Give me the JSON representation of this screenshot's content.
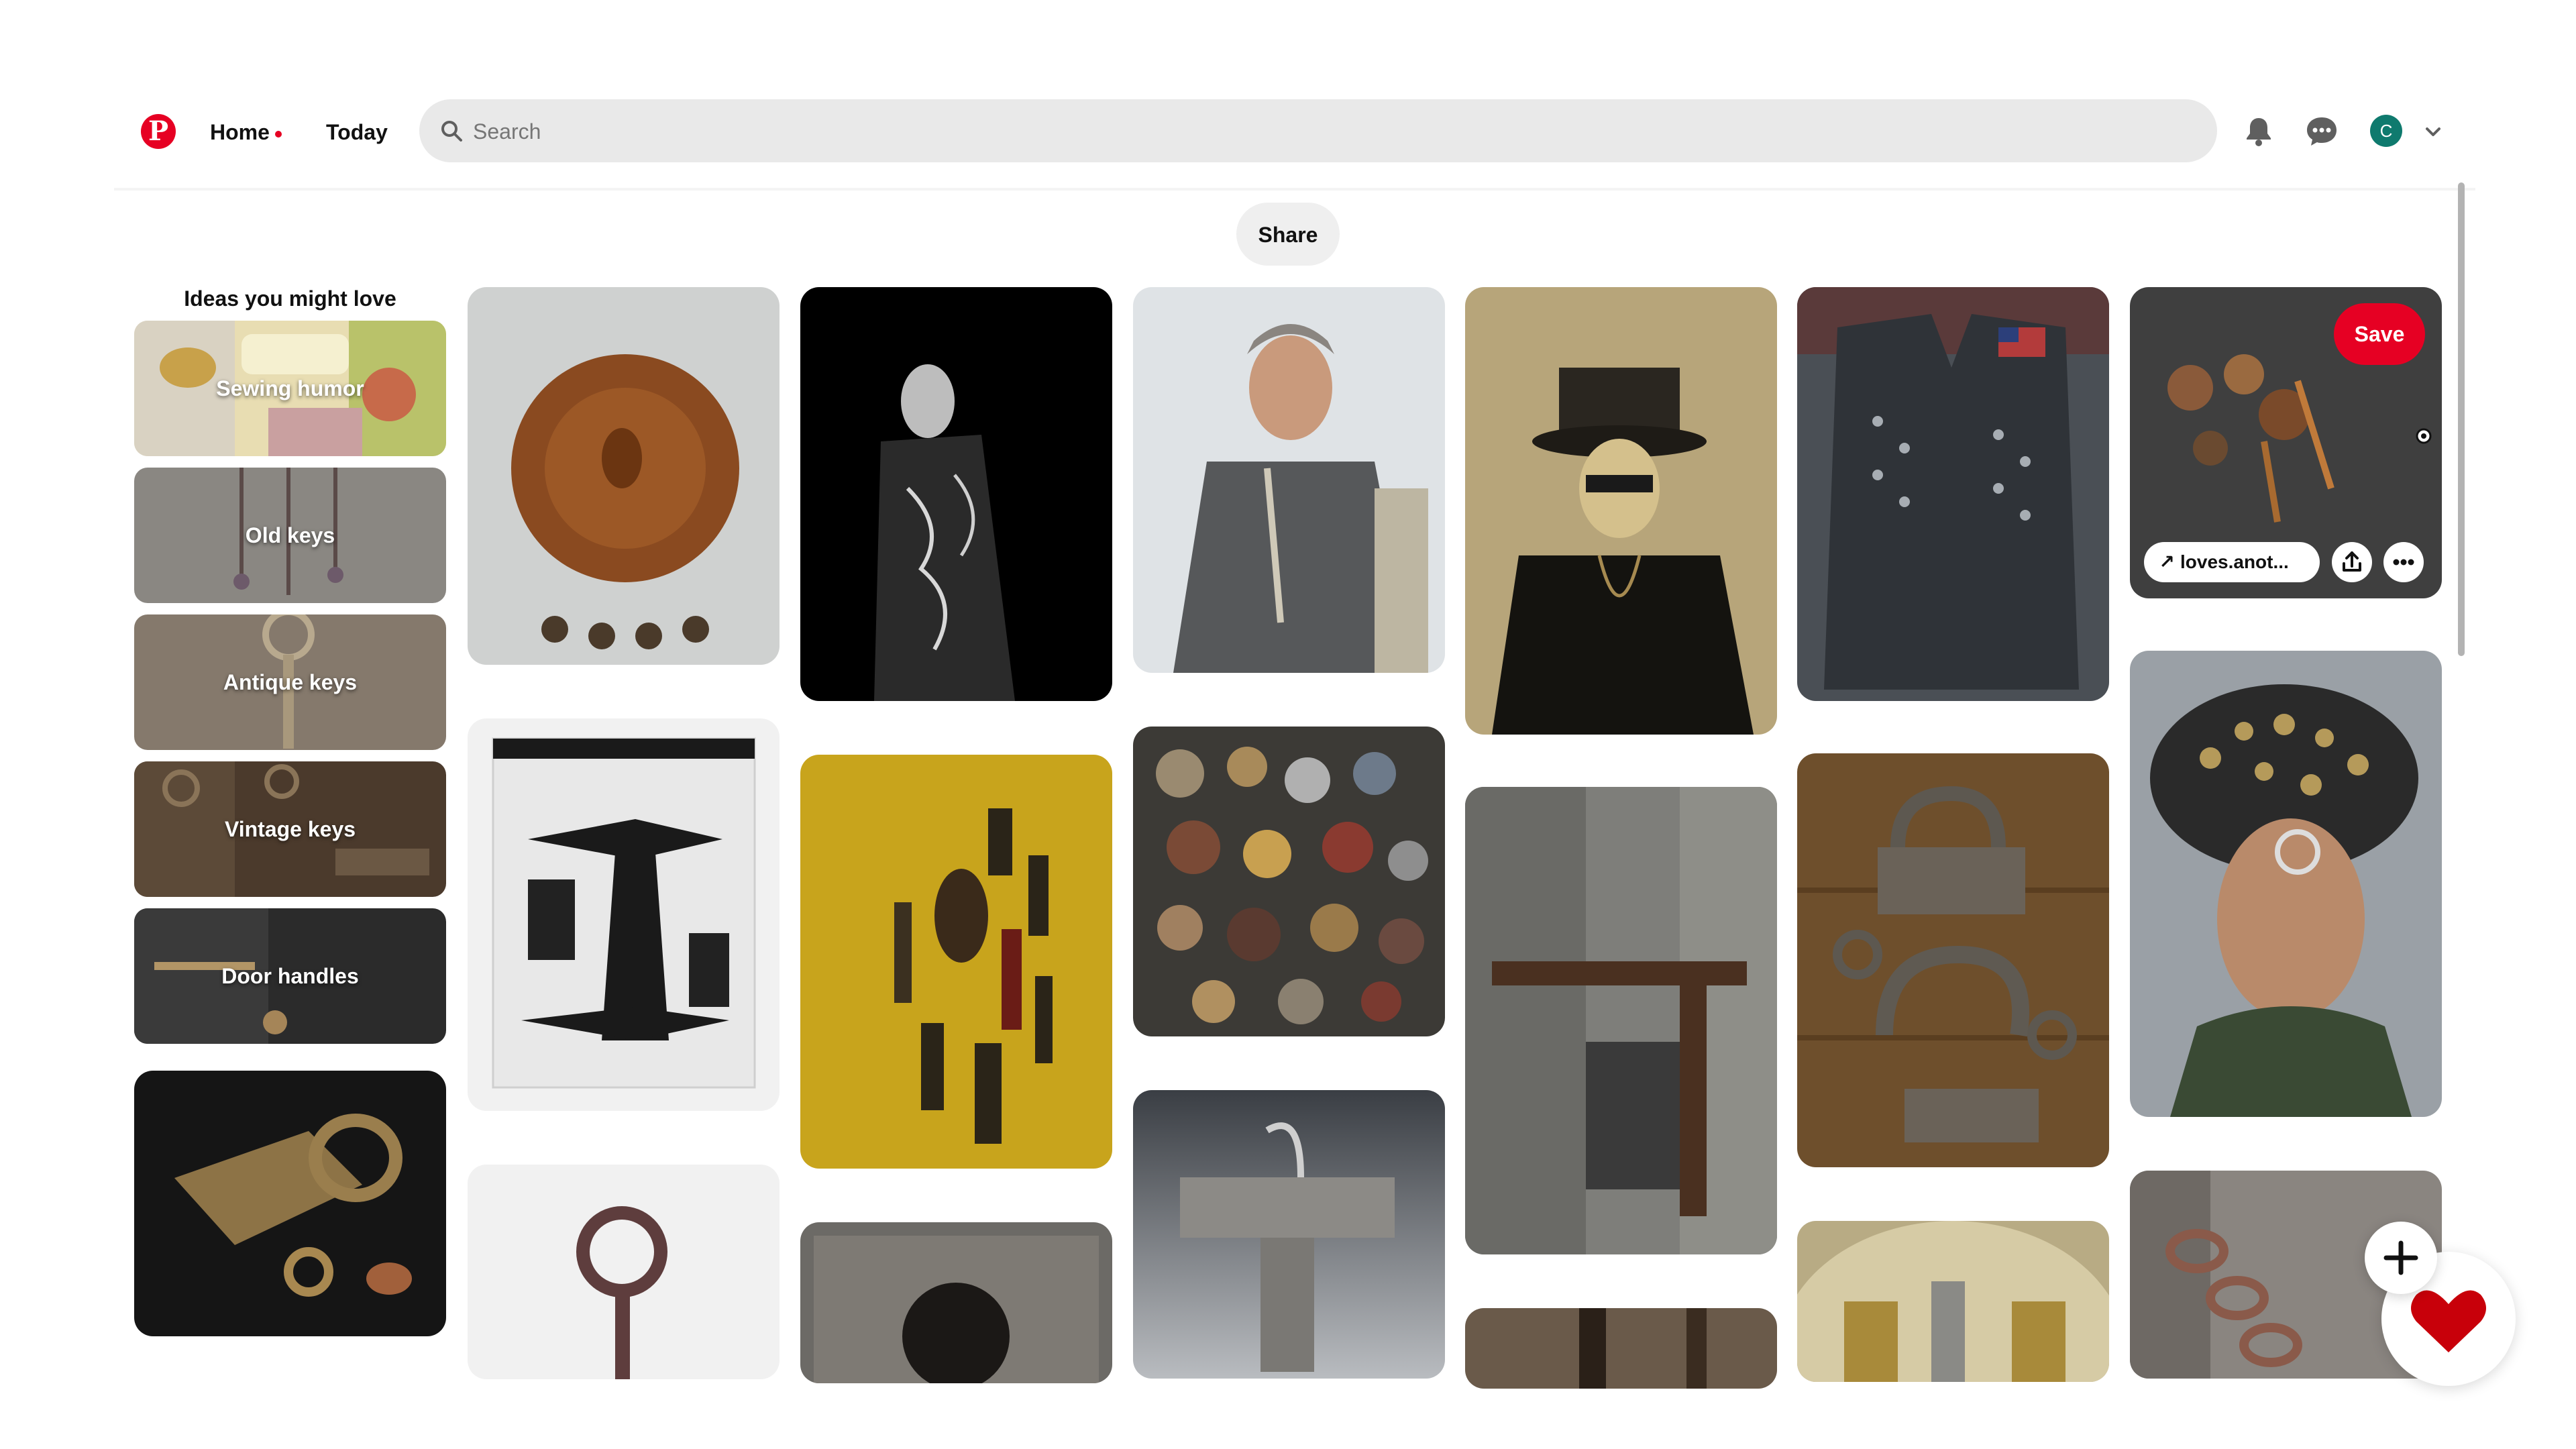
{
  "header": {
    "logo_icon": "pinterest-logo-icon",
    "logo_letter": "P",
    "nav": [
      {
        "label": "Home",
        "active": true
      },
      {
        "label": "Today",
        "active": false
      }
    ],
    "search": {
      "placeholder": "Search",
      "value": ""
    },
    "icons": [
      "bell-icon",
      "chat-icon",
      "avatar",
      "chevron-down-icon"
    ],
    "avatar_initial": "C"
  },
  "share": {
    "label": "Share"
  },
  "ideas": {
    "title": "Ideas you might love",
    "items": [
      {
        "label": "Sewing humor"
      },
      {
        "label": "Old keys"
      },
      {
        "label": "Antique keys"
      },
      {
        "label": "Vintage keys"
      },
      {
        "label": "Door handles"
      }
    ]
  },
  "hovered_pin": {
    "save_label": "Save",
    "link_label": "loves.anot...",
    "icons": [
      "arrow-up-right-icon",
      "share-icon",
      "more-icon"
    ]
  },
  "floating": {
    "icons": [
      "plus-icon",
      "heart-badge-icon"
    ]
  },
  "colors": {
    "brand": "#e60023",
    "search_bg": "#e9e9e9",
    "avatar": "#0f7a6e"
  }
}
